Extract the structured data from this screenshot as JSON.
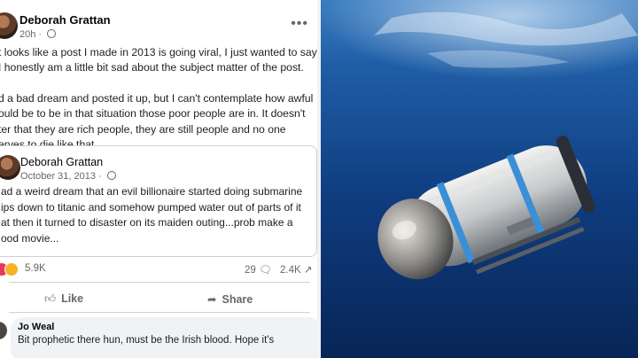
{
  "post": {
    "author": "Deborah Grattan",
    "time": "20h",
    "more": "•••",
    "paragraphs": [
      "t looks like a post I made in 2013 is going viral, I just wanted to say\nI honestly am a little bit sad about the subject matter of the post.",
      "d a bad dream and posted it up, but I can't contemplate how awful\nould be to be in that situation those poor people are in. It doesn't\nter that they are rich people, they are still people and no one\nerves to die like that"
    ]
  },
  "shared": {
    "author": "Deborah Grattan",
    "date": "October 31, 2013",
    "text": "ad a weird dream that an evil billionaire started doing submarine\nips down to titanic and somehow pumped water out of parts of it\nat then it turned to disaster on its maiden outing...prob make a\nood movie..."
  },
  "stats": {
    "reactions": "5.9K",
    "comments": "29",
    "shares": "2.4K"
  },
  "actions": {
    "like": "Like",
    "share": "Share"
  },
  "comment": {
    "author": "Jo Weal",
    "text": "Bit prophetic there hun, must be the Irish blood. Hope it's"
  },
  "colors": {
    "ocean_deep": "#0a2a5a",
    "ocean_light": "#2d6fb0",
    "meta_gray": "#65676b"
  }
}
